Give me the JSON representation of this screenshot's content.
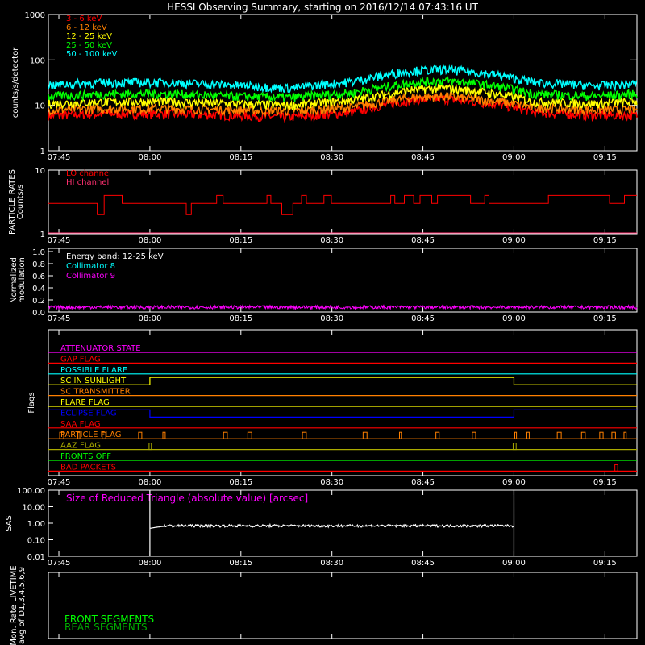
{
  "title": "HESSI Observing Summary, starting on 2016/12/14 07:43:16 UT",
  "time_ticks": [
    "07:45",
    "08:00",
    "08:15",
    "08:30",
    "08:45",
    "09:00",
    "09:15"
  ],
  "tick_minutes": [
    1.73,
    16.73,
    31.73,
    46.73,
    61.73,
    76.73,
    91.73
  ],
  "x_range_minutes": [
    0,
    97
  ],
  "colors": {
    "red": "#ff0000",
    "orange": "#ff8000",
    "yellow": "#ffff00",
    "green": "#00ff00",
    "cyan": "#00ffff",
    "magenta": "#ff00ff",
    "blue": "#0000ff",
    "olive": "#aaaa00",
    "white": "#ffffff",
    "darkgreen": "#00aa00",
    "pink": "#ff3070"
  },
  "chart_data": [
    {
      "type": "line",
      "id": "counts",
      "ylabel": "counts/s/detector",
      "ylog": true,
      "ylim": [
        1,
        1000
      ],
      "ytick_labels": [
        "1",
        "10",
        "100",
        "1000"
      ],
      "ytick_values": [
        1,
        10,
        100,
        1000
      ],
      "series": [
        {
          "name": "3 - 6 keV",
          "color": "#ff0000",
          "x": [
            0,
            10,
            20,
            30,
            40,
            50,
            55,
            60,
            65,
            70,
            75,
            80,
            90,
            97
          ],
          "y": [
            6,
            6.5,
            6.5,
            6,
            5.5,
            7,
            10,
            13,
            14,
            12,
            10,
            7,
            6,
            6
          ]
        },
        {
          "name": "6 - 12 keV",
          "color": "#ff8000",
          "x": [
            0,
            10,
            20,
            30,
            40,
            50,
            55,
            60,
            65,
            70,
            75,
            80,
            90,
            97
          ],
          "y": [
            8,
            8.5,
            8.5,
            8,
            7.5,
            9,
            12,
            15,
            16,
            14,
            12,
            9,
            8,
            8
          ]
        },
        {
          "name": "12 - 25 keV",
          "color": "#ffff00",
          "x": [
            0,
            10,
            20,
            30,
            40,
            50,
            55,
            60,
            65,
            70,
            75,
            80,
            90,
            97
          ],
          "y": [
            11,
            12,
            12,
            11,
            10,
            13,
            17,
            22,
            24,
            21,
            17,
            12,
            11,
            12
          ]
        },
        {
          "name": "25 - 50 keV",
          "color": "#00ff00",
          "x": [
            0,
            10,
            20,
            30,
            40,
            50,
            55,
            60,
            65,
            70,
            75,
            80,
            90,
            97
          ],
          "y": [
            16,
            18,
            18,
            16,
            15,
            19,
            25,
            32,
            35,
            31,
            25,
            18,
            16,
            18
          ]
        },
        {
          "name": "50 - 100 keV",
          "color": "#00ffff",
          "x": [
            0,
            10,
            20,
            30,
            40,
            50,
            55,
            60,
            65,
            70,
            75,
            80,
            90,
            97
          ],
          "y": [
            28,
            32,
            32,
            28,
            24,
            33,
            45,
            58,
            62,
            55,
            44,
            32,
            27,
            30
          ]
        }
      ]
    },
    {
      "type": "line",
      "id": "particle",
      "ylabel": "PARTICLE RATES",
      "ylabel2": "Counts/s",
      "ylog": true,
      "ylim": [
        1,
        10
      ],
      "ytick_labels": [
        "1",
        "10"
      ],
      "ytick_values": [
        1,
        10
      ],
      "series": [
        {
          "name": "LO channel",
          "color": "#ff0000",
          "y_base": 3,
          "y_high": 4,
          "y_low": 2
        },
        {
          "name": "HI channel",
          "color": "#ff3070"
        }
      ]
    },
    {
      "type": "line",
      "id": "modulation",
      "ylabel": "Normalized",
      "ylabel2": "modulation",
      "ylim": [
        0,
        1.0
      ],
      "ytick_labels": [
        "0.0",
        "0.2",
        "0.4",
        "0.6",
        "0.8",
        "1.0"
      ],
      "ytick_values": [
        0,
        0.2,
        0.4,
        0.6,
        0.8,
        1.0
      ],
      "legend_title": "Energy band: 12-25 keV",
      "series": [
        {
          "name": "Collimator 8",
          "color": "#00ffff"
        },
        {
          "name": "Collimator 9",
          "color": "#ff00ff",
          "level": 0.08
        }
      ]
    },
    {
      "type": "line",
      "id": "flags",
      "ylabel": "Flags",
      "series": [
        {
          "name": "ATTENUATOR STATE",
          "color": "#ff00ff"
        },
        {
          "name": "GAP FLAG",
          "color": "#ff0000"
        },
        {
          "name": "POSSIBLE FLARE",
          "color": "#00ffff"
        },
        {
          "name": "SC IN SUNLIGHT",
          "color": "#ffff00",
          "on": [
            [
              16.73,
              76.73
            ]
          ]
        },
        {
          "name": "SC TRANSMITTER",
          "color": "#ff8000"
        },
        {
          "name": "FLARE FLAG",
          "color": "#ffff00"
        },
        {
          "name": "ECLIPSE FLAG",
          "color": "#0000ff",
          "on": [
            [
              0,
              16.73
            ],
            [
              76.73,
              97
            ]
          ]
        },
        {
          "name": "SAA FLAG",
          "color": "#ff0000"
        },
        {
          "name": "PARTICLE FLAG",
          "color": "#ff8000",
          "spikes": [
            2,
            5,
            9,
            15,
            19,
            29,
            33,
            42,
            52,
            58,
            64,
            70,
            77,
            79,
            84,
            88,
            91,
            93,
            95
          ]
        },
        {
          "name": "AAZ FLAG",
          "color": "#aaaa00",
          "spikes": [
            16.73,
            76.73
          ]
        },
        {
          "name": "FRONTS OFF",
          "color": "#00ff00"
        },
        {
          "name": "BAD PACKETS",
          "color": "#ff0000",
          "spikes": [
            93.5
          ]
        }
      ]
    },
    {
      "type": "line",
      "id": "sas",
      "ylabel": "SAS",
      "ylog": true,
      "ylim": [
        0.01,
        100
      ],
      "ytick_labels": [
        "100.00",
        "10.00",
        "1.00",
        "0.10",
        "0.01"
      ],
      "ytick_values": [
        100,
        10,
        1,
        0.1,
        0.01
      ],
      "legend_title": "Size of Reduced Triangle (absolute value) [arcsec]",
      "series": [
        {
          "name": "Size of Reduced Triangle (absolute value) [arcsec]",
          "color": "#ffffff",
          "x_start": 16.73,
          "x_end": 76.73,
          "level": 0.7
        }
      ]
    },
    {
      "type": "line",
      "id": "livetime",
      "ylabel": "Mon. Rate LIVETIME",
      "ylabel2": "avg of D1,3,4,5,6,9",
      "series": [
        {
          "name": "FRONT SEGMENTS",
          "color": "#00ff00"
        },
        {
          "name": "REAR SEGMENTS",
          "color": "#00aa00"
        }
      ]
    }
  ]
}
